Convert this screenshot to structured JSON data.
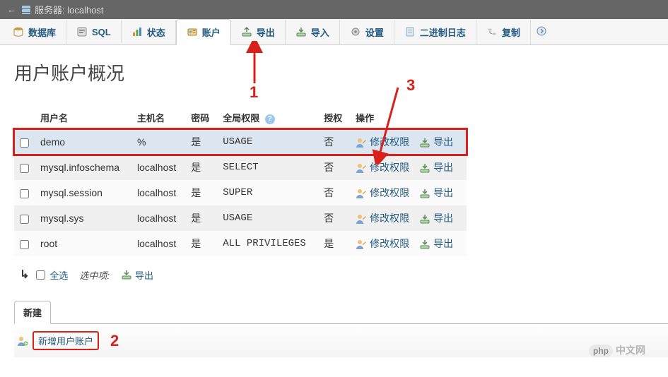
{
  "server_bar": {
    "back": "←",
    "label": "服务器: localhost"
  },
  "tabs": [
    {
      "id": "db",
      "label": "数据库",
      "active": false
    },
    {
      "id": "sql",
      "label": "SQL",
      "active": false
    },
    {
      "id": "status",
      "label": "状态",
      "active": false
    },
    {
      "id": "accounts",
      "label": "账户",
      "active": true
    },
    {
      "id": "export",
      "label": "导出",
      "active": false
    },
    {
      "id": "import",
      "label": "导入",
      "active": false
    },
    {
      "id": "settings",
      "label": "设置",
      "active": false
    },
    {
      "id": "binlog",
      "label": "二进制日志",
      "active": false
    },
    {
      "id": "replication",
      "label": "复制",
      "active": false
    }
  ],
  "heading": "用户账户概况",
  "columns": {
    "user": "用户名",
    "host": "主机名",
    "password": "密码",
    "global": "全局权限",
    "grant": "授权",
    "action": "操作"
  },
  "rows": [
    {
      "user": "demo",
      "host": "%",
      "password": "是",
      "global": "USAGE",
      "grant": "否",
      "highlight": true
    },
    {
      "user": "mysql.infoschema",
      "host": "localhost",
      "password": "是",
      "global": "SELECT",
      "grant": "否",
      "highlight": false
    },
    {
      "user": "mysql.session",
      "host": "localhost",
      "password": "是",
      "global": "SUPER",
      "grant": "否",
      "highlight": false
    },
    {
      "user": "mysql.sys",
      "host": "localhost",
      "password": "是",
      "global": "USAGE",
      "grant": "否",
      "highlight": false
    },
    {
      "user": "root",
      "host": "localhost",
      "password": "是",
      "global": "ALL PRIVILEGES",
      "grant": "是",
      "highlight": false
    }
  ],
  "row_actions": {
    "edit": "修改权限",
    "export": "导出"
  },
  "bulk": {
    "check_all": "全选",
    "with_selected": "选中项:",
    "export": "导出"
  },
  "new_section": {
    "title": "新建",
    "add_user": "新增用户账户"
  },
  "annotations": {
    "a1": "1",
    "a2": "2",
    "a3": "3"
  },
  "watermark": {
    "php": "php",
    "cn": "中文网"
  }
}
